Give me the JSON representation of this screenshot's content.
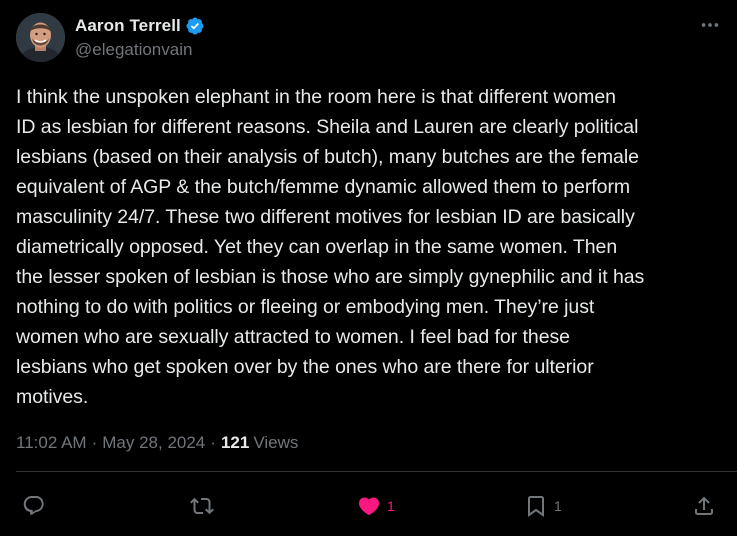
{
  "author": {
    "display_name": "Aaron Terrell",
    "handle": "@elegationvain",
    "verified": true
  },
  "tweet": {
    "text": "I think the unspoken elephant in the room here is that different women\nID as lesbian for different reasons. Sheila and Lauren are clearly political\nlesbians (based on their analysis of butch), many butches are the female\nequivalent of AGP & the butch/femme dynamic allowed them to perform\nmasculinity 24/7. These two different motives for lesbian ID are basically\ndiametrically opposed. Yet they can overlap in the same women. Then\nthe lesser spoken of lesbian is those who are simply gynephilic and it has\nnothing to do with politics or fleeing or embodying men. They’re just\nwomen who are sexually attracted to women. I feel bad for these\nlesbians who get spoken over by the ones who are there for ulterior\nmotives.",
    "time": "11:02 AM",
    "date": "May 28, 2024",
    "separator": "·",
    "views_count": "121",
    "views_label": "Views"
  },
  "actions": {
    "reply": {
      "icon": "reply-icon",
      "count": ""
    },
    "repost": {
      "icon": "repost-icon",
      "count": ""
    },
    "like": {
      "icon": "heart-filled-icon",
      "count": "1",
      "active": true
    },
    "bookmark": {
      "icon": "bookmark-icon",
      "count": "1"
    },
    "share": {
      "icon": "share-icon",
      "count": ""
    }
  },
  "colors": {
    "background": "#000000",
    "text": "#e7e9ea",
    "secondary": "#71767b",
    "verified": "#1d9bf0",
    "like": "#f91880",
    "divider": "#2f3336"
  }
}
